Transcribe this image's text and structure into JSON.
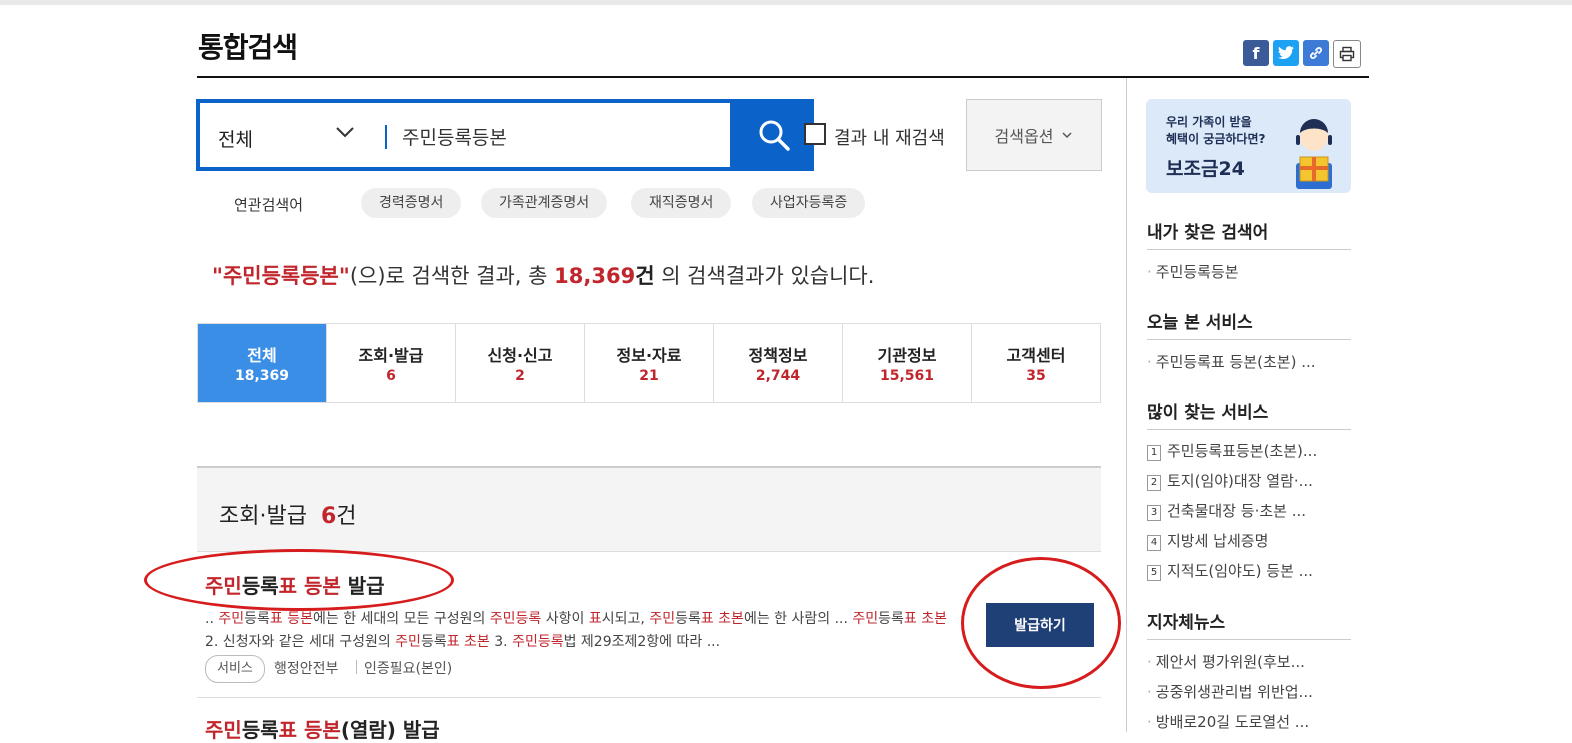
{
  "header": {
    "title": "통합검색"
  },
  "search": {
    "category": "전체",
    "query": "주민등록등본",
    "recheck_label": "결과 내 재검색",
    "options_label": "검색옵션"
  },
  "related": {
    "label": "연관검색어",
    "chips": [
      "경력증명서",
      "가족관계증명서",
      "재직증명서",
      "사업자등록증"
    ]
  },
  "summary": {
    "query": "\"주민등록등본\"",
    "part1": "(으)로 검색한 결과, 총 ",
    "count": "18,369",
    "unit": "건",
    "part2": " 의 검색결과가 있습니다."
  },
  "tabs": [
    {
      "label": "전체",
      "count": "18,369"
    },
    {
      "label": "조회·발급",
      "count": "6"
    },
    {
      "label": "신청·신고",
      "count": "2"
    },
    {
      "label": "정보·자료",
      "count": "21"
    },
    {
      "label": "정책정보",
      "count": "2,744"
    },
    {
      "label": "기관정보",
      "count": "15,561"
    },
    {
      "label": "고객센터",
      "count": "35"
    }
  ],
  "section": {
    "title": "조회·발급",
    "count": "6",
    "unit": "건"
  },
  "result1": {
    "title": [
      {
        "t": "주민",
        "h": true
      },
      {
        "t": "등록",
        "h": false
      },
      {
        "t": "표",
        "h": true
      },
      {
        "t": " ",
        "h": false
      },
      {
        "t": "등본",
        "h": true
      },
      {
        "t": " 발급",
        "h": false
      }
    ],
    "desc": [
      {
        "t": ".. ",
        "h": false
      },
      {
        "t": "주민",
        "h": true
      },
      {
        "t": "등록",
        "h": false
      },
      {
        "t": "표 등본",
        "h": true
      },
      {
        "t": "에는 한 세대의 모든 구성원의 ",
        "h": false
      },
      {
        "t": "주민등록",
        "h": true
      },
      {
        "t": " 사항이 ",
        "h": false
      },
      {
        "t": "표",
        "h": true
      },
      {
        "t": "시되고, ",
        "h": false
      },
      {
        "t": "주민",
        "h": true
      },
      {
        "t": "등록",
        "h": false
      },
      {
        "t": "표 초본",
        "h": true
      },
      {
        "t": "에는 한 사람의 ... ",
        "h": false
      },
      {
        "t": "주민",
        "h": true
      },
      {
        "t": "등록",
        "h": false
      },
      {
        "t": "표 초본",
        "h": true
      },
      {
        "t": " 2. 신청자와 같은 세대 구성원의 ",
        "h": false
      },
      {
        "t": "주민",
        "h": true
      },
      {
        "t": "등록",
        "h": false
      },
      {
        "t": "표 초본",
        "h": true
      },
      {
        "t": " 3. ",
        "h": false
      },
      {
        "t": "주민등록",
        "h": true
      },
      {
        "t": "법 제29조제2항에 따라 ...",
        "h": false
      }
    ],
    "tag": "서비스",
    "agency": "행정안전부",
    "auth": "인증필요(본인)",
    "button": "발급하기"
  },
  "result2": {
    "title": [
      {
        "t": "주민",
        "h": true
      },
      {
        "t": "등록",
        "h": false
      },
      {
        "t": "표",
        "h": true
      },
      {
        "t": " ",
        "h": false
      },
      {
        "t": "등본",
        "h": true
      },
      {
        "t": "(열람) 발급",
        "h": false
      }
    ]
  },
  "sidebar": {
    "banner": {
      "line1": "우리 가족이 받을",
      "line2": "혜택이 궁금하다면?",
      "line3": "보조금24"
    },
    "my_searches": {
      "title": "내가 찾은 검색어",
      "items": [
        "주민등록등본"
      ]
    },
    "today": {
      "title": "오늘 본 서비스",
      "items": [
        "주민등록표 등본(초본) ..."
      ]
    },
    "popular": {
      "title": "많이 찾는 서비스",
      "items": [
        {
          "rank": "1",
          "label": "주민등록표등본(초본)..."
        },
        {
          "rank": "2",
          "label": "토지(임야)대장 열람·..."
        },
        {
          "rank": "3",
          "label": "건축물대장 등·초본 ..."
        },
        {
          "rank": "4",
          "label": "지방세 납세증명"
        },
        {
          "rank": "5",
          "label": "지적도(임야도) 등본 ..."
        }
      ]
    },
    "news": {
      "title": "지자체뉴스",
      "items": [
        "제안서 평가위원(후보...",
        "공중위생관리법 위반업...",
        "방배로20길 도로열선 ..."
      ]
    }
  },
  "colors": {
    "brand_blue": "#0b62c8",
    "active_tab": "#3a8ee6",
    "highlight": "#c0262c",
    "issue_button": "#1f3f77",
    "annotation_red": "#d61c1c"
  }
}
